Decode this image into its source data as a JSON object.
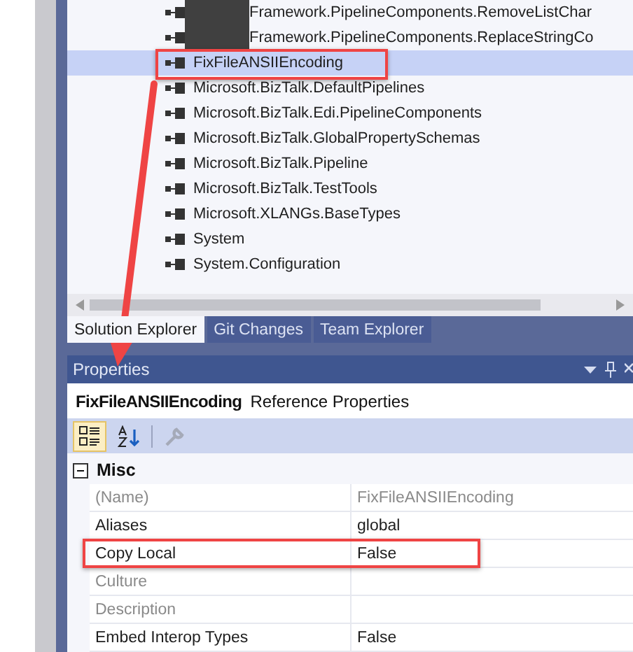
{
  "solution_explorer": {
    "tree_items": [
      {
        "label": "Framework.PipelineComponents.RemoveListChar",
        "redacted": true,
        "selected": false
      },
      {
        "label": "Framework.PipelineComponents.ReplaceStringCo",
        "redacted": true,
        "selected": false
      },
      {
        "label": "FixFileANSIIEncoding",
        "redacted": false,
        "selected": true
      },
      {
        "label": "Microsoft.BizTalk.DefaultPipelines",
        "redacted": false,
        "selected": false
      },
      {
        "label": "Microsoft.BizTalk.Edi.PipelineComponents",
        "redacted": false,
        "selected": false
      },
      {
        "label": "Microsoft.BizTalk.GlobalPropertySchemas",
        "redacted": false,
        "selected": false
      },
      {
        "label": "Microsoft.BizTalk.Pipeline",
        "redacted": false,
        "selected": false
      },
      {
        "label": "Microsoft.BizTalk.TestTools",
        "redacted": false,
        "selected": false
      },
      {
        "label": "Microsoft.XLANGs.BaseTypes",
        "redacted": false,
        "selected": false
      },
      {
        "label": "System",
        "redacted": false,
        "selected": false
      },
      {
        "label": "System.Configuration",
        "redacted": false,
        "selected": false
      }
    ],
    "tabs": [
      {
        "label": "Solution Explorer",
        "selected": true
      },
      {
        "label": "Git Changes",
        "selected": false
      },
      {
        "label": "Team Explorer",
        "selected": false
      }
    ]
  },
  "properties": {
    "title": "Properties",
    "object_name": "FixFileANSIIEncoding",
    "object_type": "Reference Properties",
    "toolbar": [
      {
        "kind": "categorized",
        "selected": true,
        "disabled": false
      },
      {
        "kind": "alphabetical",
        "selected": false,
        "disabled": false
      },
      {
        "kind": "property_pages",
        "selected": false,
        "disabled": true
      }
    ],
    "category": {
      "label": "Misc",
      "expanded": true
    },
    "rows": [
      {
        "name": "(Name)",
        "value": "FixFileANSIIEncoding",
        "readonly": true
      },
      {
        "name": "Aliases",
        "value": "global",
        "readonly": false
      },
      {
        "name": "Copy Local",
        "value": "False",
        "readonly": false
      },
      {
        "name": "Culture",
        "readonly": true
      },
      {
        "name": "Description",
        "readonly": true
      },
      {
        "name": "Embed Interop Types",
        "value": "False",
        "readonly": false
      }
    ]
  }
}
